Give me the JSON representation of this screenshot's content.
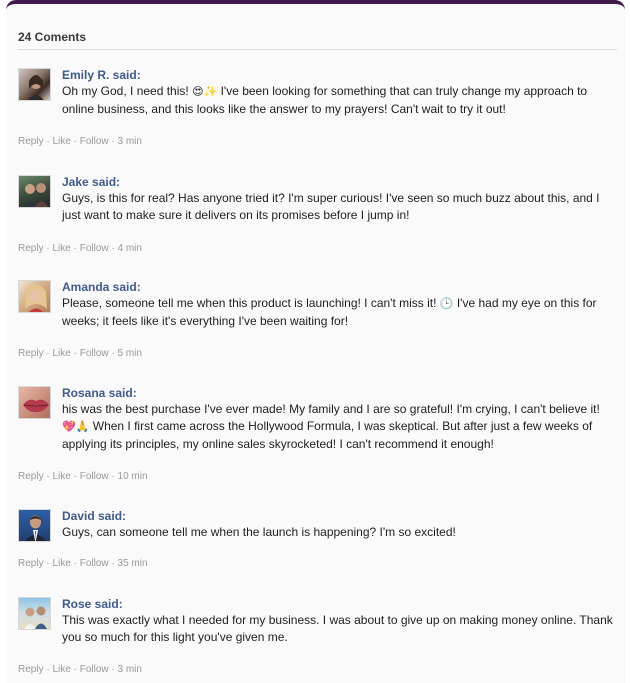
{
  "header": {
    "title": "24 Coments"
  },
  "actions": {
    "reply": "Reply",
    "like": "Like",
    "follow": "Follow",
    "sep": " · "
  },
  "comments": [
    {
      "author": "Emily R. said:",
      "avatar_icon": "woman-portrait-avatar",
      "text_before": "Oh my God, I need this! ",
      "emoji": "😍✨",
      "text_after": " I've been looking for something that can truly change my approach to online business, and this looks like the answer to my prayers! Can't wait to try it out!",
      "time": "3 min"
    },
    {
      "author": "Jake said:",
      "avatar_icon": "couple-photo-avatar",
      "text_before": "Guys, is this for real? Has anyone tried it? I'm super curious! I've seen so much buzz about this, and I just want to make sure it delivers on its promises before I jump in!",
      "emoji": "",
      "text_after": "",
      "time": "4 min"
    },
    {
      "author": "Amanda said:",
      "avatar_icon": "blonde-woman-avatar",
      "text_before": "Please, someone tell me when this product is launching! I can't miss it! ",
      "emoji": "🕒",
      "text_after": " I've had my eye on this for weeks; it feels like it's everything I've been waiting for!",
      "time": "5 min"
    },
    {
      "author": "Rosana said:",
      "avatar_icon": "lips-closeup-avatar",
      "text_before": "his was the best purchase I've ever made! My family and I are so grateful! I'm crying, I can't believe it! ",
      "emoji": "💖🙏",
      "text_after": " When I first came across the Hollywood Formula, I was skeptical. But after just a few weeks of applying its principles, my online sales skyrocketed! I can't recommend it enough!",
      "time": "10 min"
    },
    {
      "author": "David said:",
      "avatar_icon": "man-in-suit-avatar",
      "text_before": "Guys, can someone tell me when the launch is happening? I'm so excited!",
      "emoji": "",
      "text_after": "",
      "time": "35 min"
    },
    {
      "author": "Rose said:",
      "avatar_icon": "beach-couple-avatar",
      "text_before": "This was exactly what I needed for my business. I was about to give up on making money online. Thank you so much for this light you've given me.",
      "emoji": "",
      "text_after": "",
      "time": "3 min"
    }
  ]
}
